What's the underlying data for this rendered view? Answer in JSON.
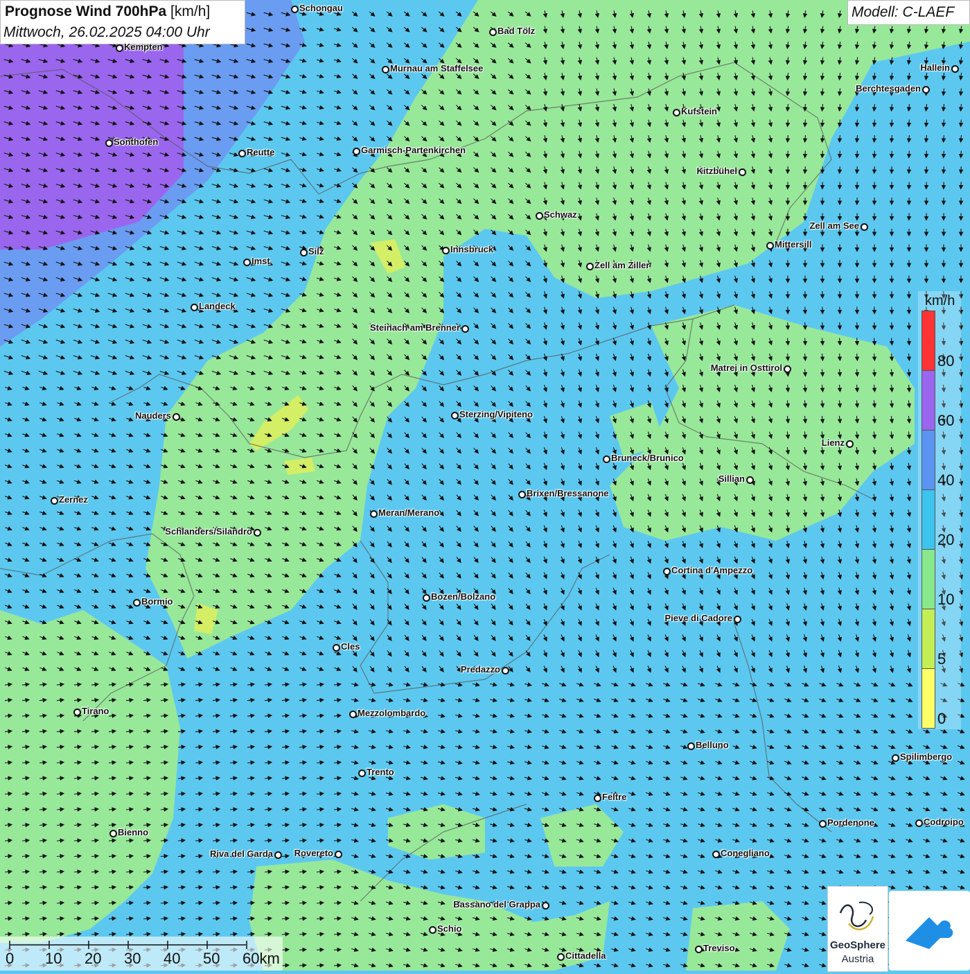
{
  "title": {
    "bold": "Prognose Wind 700hPa",
    "unit": "[km/h]",
    "datetime": "Mittwoch, 26.02.2025 04:00 Uhr"
  },
  "model": "Modell: C-LAEF",
  "legend": {
    "unit": "km/h",
    "ticks": [
      "80",
      "60",
      "40",
      "20",
      "10",
      "5",
      "0"
    ],
    "colors": [
      "#ff3333",
      "#9a66ee",
      "#5b93f2",
      "#3cc3ee",
      "#88e88c",
      "#c4ee55",
      "#ffff66"
    ]
  },
  "scale": {
    "labels": [
      "0",
      "10",
      "20",
      "30",
      "40",
      "50",
      "60km"
    ]
  },
  "logo": {
    "name": "GeoSphere",
    "sub": "Austria"
  },
  "cities": [
    "Schongau",
    "Bad Tölz",
    "Kempten",
    "Murnau am Staffelsee",
    "Hallein",
    "Berchtesgaden",
    "Kufstein",
    "Sonthofen",
    "Reutte",
    "Garmisch-Partenkirchen",
    "Kitzbühel",
    "Schwaz",
    "Zell am See",
    "Mittersill",
    "Innsbruck",
    "Silz",
    "Imst",
    "Zell am Ziller",
    "Landeck",
    "Steinach am Brenner",
    "Matrei in Osttirol",
    "Nauders",
    "Sterzing/Vipiteno",
    "Lienz",
    "Bruneck/Brunico",
    "Sillian",
    "Zernez",
    "Brixen/Bressanone",
    "Meran/Merano",
    "Schlanders/Silandro",
    "Cortina d'Ampezzo",
    "Bozen/Bolzano",
    "Bormio",
    "Pieve di Cadore",
    "Cles",
    "Predazzo",
    "Tirano",
    "Mezzolombardo",
    "Belluno",
    "Spilimbergo",
    "Trento",
    "Feltre",
    "Bienno",
    "Pordenone",
    "Codroipo",
    "Riva del Garda",
    "Rovereto",
    "Conegliano",
    "Bassano del Grappa",
    "Schio",
    "Treviso",
    "Cittadella"
  ],
  "colors": {
    "purple": "#9a66ee",
    "blue": "#5b93f2",
    "cyan": "#5cc8f0",
    "green": "#98e89a",
    "yellow": "#d4ee66"
  }
}
